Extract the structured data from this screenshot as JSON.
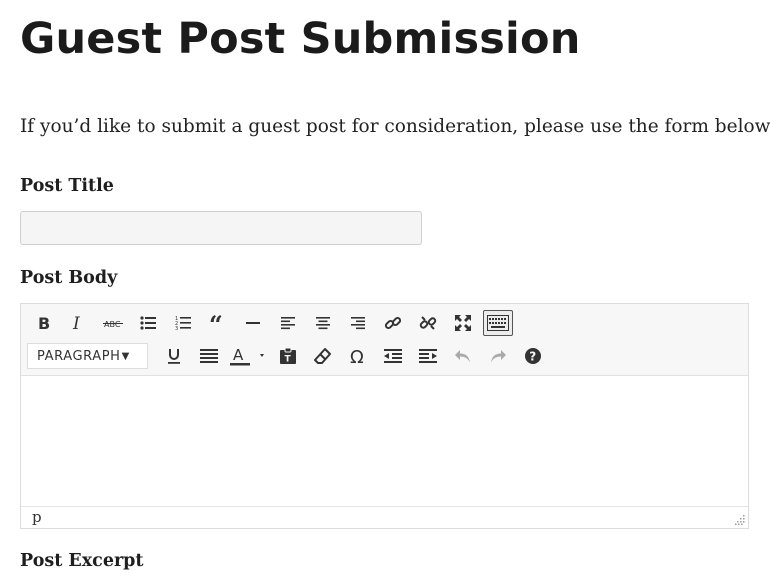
{
  "page": {
    "title": "Guest Post Submission",
    "intro": "If you’d like to submit a guest post for consideration, please use the form below:"
  },
  "form": {
    "post_title_label": "Post Title",
    "post_title_value": "",
    "post_body_label": "Post Body",
    "post_excerpt_label": "Post Excerpt"
  },
  "editor": {
    "format_select_value": "PARAGRAPH",
    "status_path": "p",
    "toolbar_row1": [
      "bold-icon",
      "italic-icon",
      "strikethrough-icon",
      "bullet-list-icon",
      "numbered-list-icon",
      "blockquote-icon",
      "horizontal-line-icon",
      "align-left-icon",
      "align-center-icon",
      "align-right-icon",
      "link-icon",
      "unlink-icon",
      "fullscreen-icon",
      "toolbar-toggle-icon"
    ],
    "toolbar_row2": [
      "format-select",
      "underline-icon",
      "justify-icon",
      "text-color-icon",
      "paste-text-icon",
      "clear-formatting-icon",
      "special-character-icon",
      "outdent-icon",
      "indent-icon",
      "undo-icon",
      "redo-icon",
      "help-icon"
    ]
  }
}
